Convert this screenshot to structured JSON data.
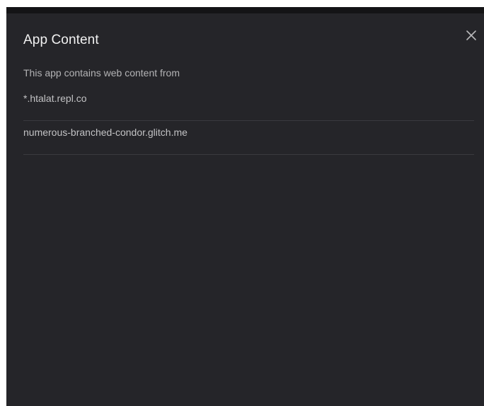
{
  "dialog": {
    "title": "App Content",
    "description": "This app contains web content from",
    "close_icon": "close-icon",
    "domains": [
      "*.htalat.repl.co",
      "numerous-branched-condor.glitch.me"
    ]
  },
  "colors": {
    "background": "#252529",
    "topbar": "#141416",
    "title": "#f1f1f1",
    "text": "#b3b3b5",
    "divider": "#3a3a3f"
  }
}
